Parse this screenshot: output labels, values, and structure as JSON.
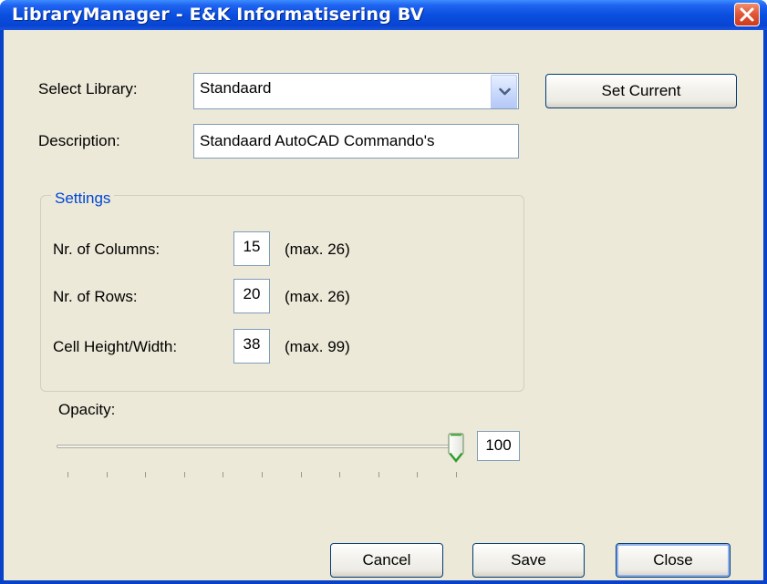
{
  "window": {
    "title": "LibraryManager - E&K Informatisering BV"
  },
  "form": {
    "select_library_label": "Select Library:",
    "select_library_value": "Standaard",
    "description_label": "Description:",
    "description_value": "Standaard AutoCAD Commando's",
    "set_current_label": "Set Current"
  },
  "settings": {
    "title": "Settings",
    "columns_label": "Nr. of Columns:",
    "columns_value": "15",
    "columns_max": "(max. 26)",
    "rows_label": "Nr. of Rows:",
    "rows_value": "20",
    "rows_max": "(max. 26)",
    "cell_label": "Cell Height/Width:",
    "cell_value": "38",
    "cell_max": "(max. 99)"
  },
  "opacity": {
    "label": "Opacity:",
    "value": 100,
    "value_text": "100",
    "min": 0,
    "max": 100,
    "tick_count": 11
  },
  "buttons": {
    "cancel": "Cancel",
    "save": "Save",
    "close": "Close"
  },
  "colors": {
    "titlebar": "#0a4fde",
    "face": "#ece9d8",
    "group_title": "#0046d5",
    "close_button": "#e2583a"
  },
  "icons": {
    "close": "close-icon",
    "dropdown": "chevron-down-icon",
    "slider_thumb": "slider-thumb"
  }
}
